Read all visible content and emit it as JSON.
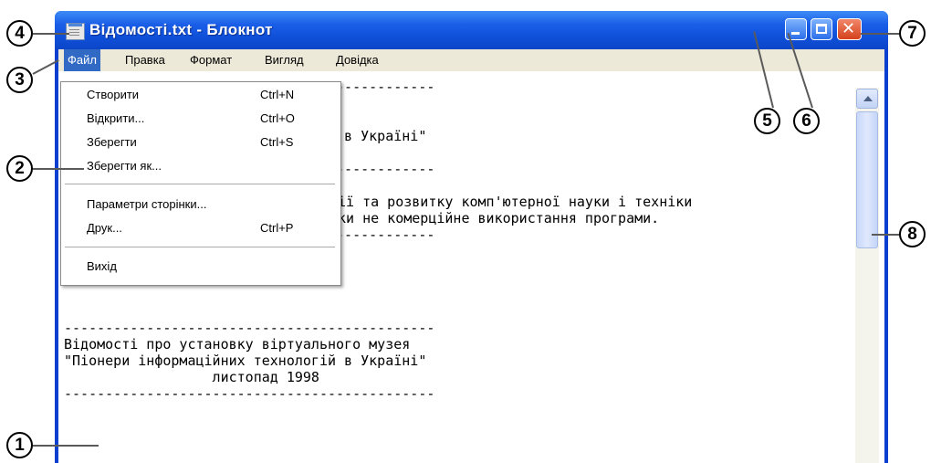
{
  "window": {
    "title": "Відомості.txt - Блокнот",
    "buttons": {
      "minimize": "minimize",
      "maximize": "maximize",
      "close": "✕"
    }
  },
  "menubar": {
    "items": [
      "Файл",
      "Правка",
      "Формат",
      "Вигляд",
      "Довідка"
    ],
    "active": "Файл"
  },
  "file_menu": {
    "items": [
      {
        "label": "Створити",
        "shortcut": "Ctrl+N"
      },
      {
        "label": "Відкрити...",
        "shortcut": "Ctrl+O"
      },
      {
        "label": "Зберегти",
        "shortcut": "Ctrl+S"
      },
      {
        "label": "Зберегти як...",
        "shortcut": ""
      },
      {
        "label": "Параметри сторінки...",
        "shortcut": ""
      },
      {
        "label": "Друк...",
        "shortcut": "Ctrl+P"
      },
      {
        "label": "Вихід",
        "shortcut": ""
      }
    ]
  },
  "document": {
    "lines": [
      "---------------------------------------------",
      "",
      "",
      "\"Піонери інформаційних технологій в Україні\"",
      "",
      "---------------------------------------------",
      "",
      "ії та розвитку комп'ютерної науки і техніки",
      "ки не комерційне використання програми.",
      "---------------------------------------------",
      "",
      "",
      "---------------------------------------------",
      "Відомості про установку віртуального музея",
      "\"Піонери інформаційних технологій в Україні\"",
      "                  листопад 1998",
      "---------------------------------------------"
    ]
  },
  "callouts": [
    "1",
    "2",
    "3",
    "4",
    "5",
    "6",
    "7",
    "8"
  ],
  "colors": {
    "titlebar": "#0f4fd8",
    "menu_highlight": "#316ac5",
    "close_button": "#d4421c"
  }
}
